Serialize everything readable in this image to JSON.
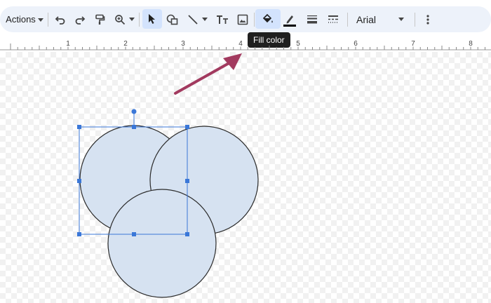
{
  "toolbar": {
    "actions_label": "Actions",
    "font_name": "Arial",
    "tooltip": "Fill color",
    "icons": [
      "undo-icon",
      "redo-icon",
      "paint-format-icon",
      "zoom-icon",
      "select-icon",
      "shape-icon",
      "line-icon",
      "text-box-icon",
      "image-icon",
      "fill-color-icon",
      "border-color-icon",
      "border-weight-icon",
      "border-dash-icon",
      "more-options-icon"
    ]
  },
  "ruler": {
    "labels": [
      "1",
      "2",
      "3",
      "4",
      "5",
      "6",
      "7",
      "8"
    ]
  },
  "colors": {
    "toolbar_bg": "#edf2fa",
    "selected_bg": "#d3e3fd",
    "circle_fill": "#d6e2f1",
    "circle_stroke": "#2b2b2b",
    "selection": "#3a77d8",
    "arrow": "#a23a5f"
  }
}
